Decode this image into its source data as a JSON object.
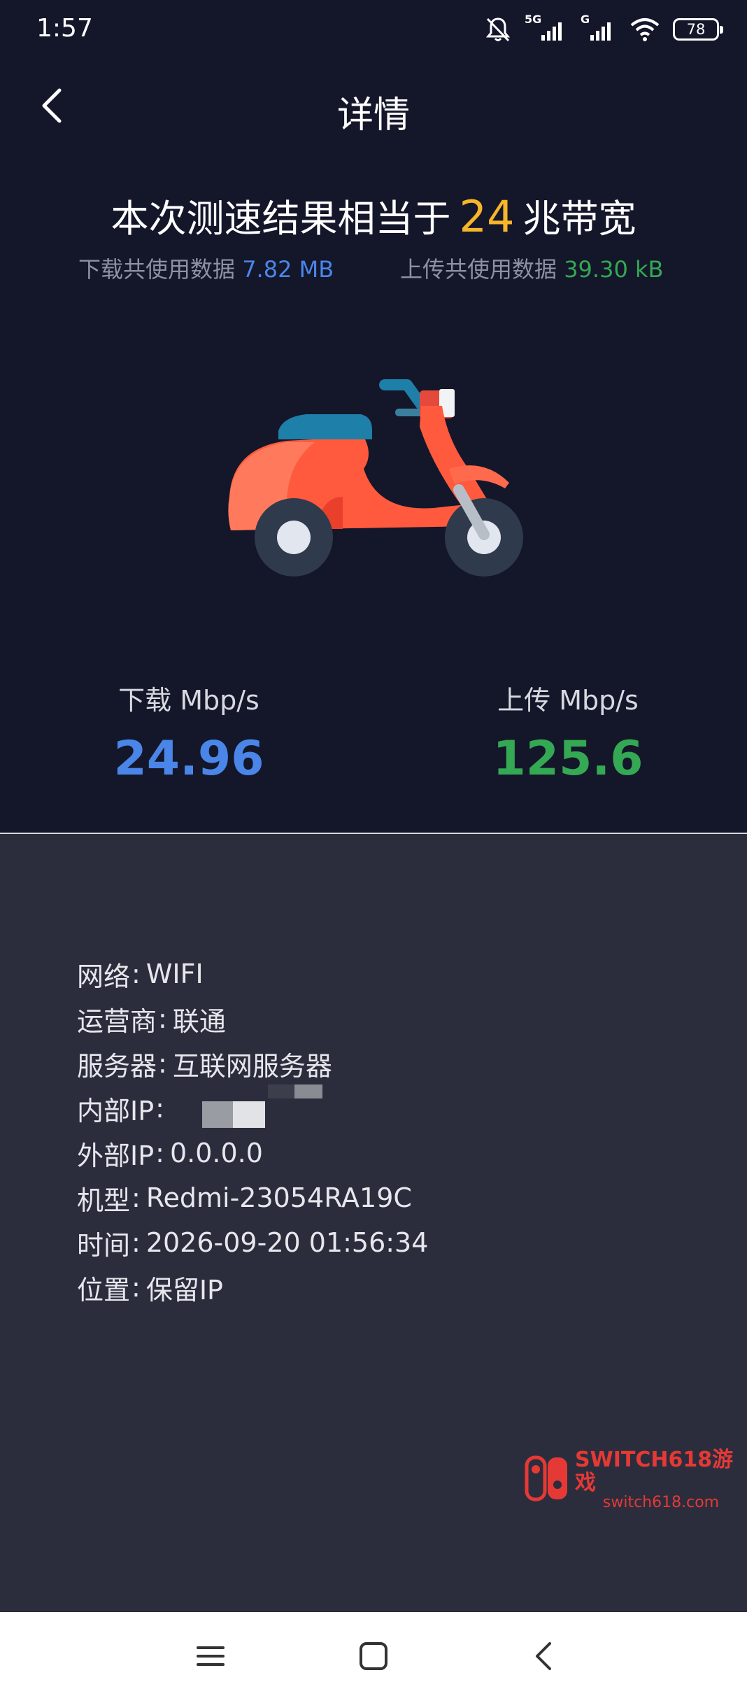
{
  "status_bar": {
    "time": "1:57",
    "signal_1_label": "5G",
    "signal_2_label": "G",
    "battery": "78"
  },
  "header": {
    "title": "详情"
  },
  "summary": {
    "prefix": "本次测速结果相当于",
    "bandwidth": "24",
    "suffix": "兆带宽",
    "download_usage_label": "下载共使用数据",
    "download_usage_value": "7.82 MB",
    "upload_usage_label": "上传共使用数据",
    "upload_usage_value": "39.30 kB"
  },
  "results": {
    "download_label": "下载 Mbp/s",
    "download_value": "24.96",
    "upload_label": "上传 Mbp/s",
    "upload_value": "125.6"
  },
  "details": {
    "separator": ":",
    "network_label": "网络",
    "network_value": "WIFI",
    "carrier_label": "运营商",
    "carrier_value": "联通",
    "server_label": "服务器",
    "server_value": "互联网服务器",
    "internal_ip_label": "内部IP",
    "external_ip_label": "外部IP",
    "external_ip_value": "0.0.0.0",
    "model_label": "机型",
    "model_value": "Redmi-23054RA19C",
    "time_label": "时间",
    "time_value": "2026-09-20 01:56:34",
    "location_label": "位置",
    "location_value": "保留IP"
  },
  "watermark": {
    "main": "SWITCH618游戏",
    "sub": "switch618.com"
  },
  "colors": {
    "background_top": "#14162a",
    "background_bottom": "#2b2d3d",
    "bandwidth_highlight": "#f7b529",
    "download": "#4a86e8",
    "upload": "#34a853"
  },
  "icons": {
    "back": "chevron-left-icon",
    "mute": "bell-off-icon",
    "wifi": "wifi-icon",
    "scooter": "scooter-illustration",
    "nav_menu": "menu-icon",
    "nav_home": "square-home-icon",
    "nav_back": "chevron-left-icon"
  }
}
